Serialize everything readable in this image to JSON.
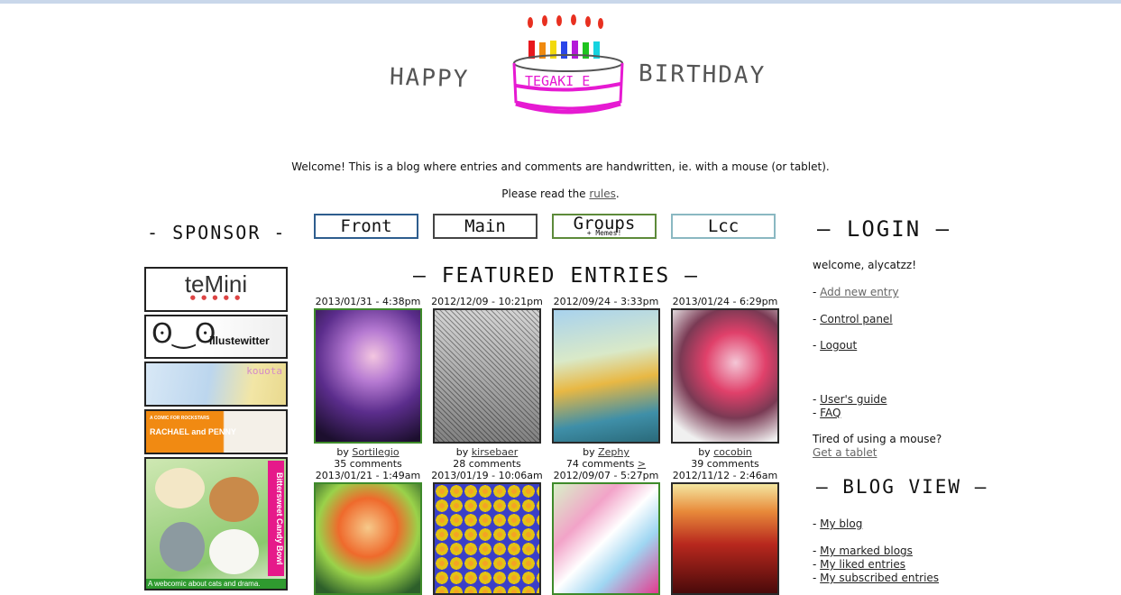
{
  "header": {
    "happy": "HAPPY",
    "birthday": "BIRTHDAY",
    "cake_text": "TEGAKI E",
    "welcome": "Welcome! This is a blog where entries and comments are handwritten, ie. with a mouse (or tablet).",
    "rules_prefix": "Please read the ",
    "rules_link": "rules",
    "rules_suffix": "."
  },
  "nav": {
    "front": "Front",
    "main": "Main",
    "groups": "Groups",
    "groups_sub": "+ Memes!",
    "lcc": "Lcc"
  },
  "sponsor": {
    "title": "- SPONSOR -",
    "temini": "teMini",
    "temini_dots": "● ● ● ● ●",
    "illustwitter": "illustewitter",
    "illus_face": "ʘ‿ʘ",
    "kouota": "kouota",
    "rachael_small": "A COMIC FOR ROCKSTARS",
    "rachael_title": "RACHAEL and PENNY",
    "cats_side": "Bittersweet Candy Bowl",
    "cats_caption": "A webcomic about cats and drama."
  },
  "featured": {
    "title": "— FEATURED ENTRIES —",
    "entries": [
      {
        "date": "2013/01/31 - 4:38pm",
        "author": "Sortilegio",
        "comments": "35 comments",
        "more": ""
      },
      {
        "date": "2012/12/09 - 10:21pm",
        "author": "kirsebaer",
        "comments": "28 comments",
        "more": ""
      },
      {
        "date": "2012/09/24 - 3:33pm",
        "author": "Zephy",
        "comments": "74 comments",
        "more": ">"
      },
      {
        "date": "2013/01/24 - 6:29pm",
        "author": "cocobin",
        "comments": "39 comments",
        "more": ""
      },
      {
        "date": "2013/01/21 - 1:49am",
        "author": "",
        "comments": "",
        "more": ""
      },
      {
        "date": "2013/01/19 - 10:06am",
        "author": "",
        "comments": "",
        "more": ""
      },
      {
        "date": "2012/09/07 - 5:27pm",
        "author": "",
        "comments": "",
        "more": ""
      },
      {
        "date": "2012/11/12 - 2:46am",
        "author": "",
        "comments": "",
        "more": ""
      }
    ]
  },
  "login": {
    "title": "— LOGIN —",
    "welcome": "welcome, alycatzz!",
    "add_entry": "Add new entry",
    "control_panel": "Control panel",
    "logout": "Logout",
    "users_guide": "User's guide",
    "faq": "FAQ",
    "tired": "Tired of using a mouse?",
    "get_tablet": "Get a tablet",
    "dash": "- ",
    "by": "by "
  },
  "blogview": {
    "title": "— BLOG VIEW —",
    "my_blog": "My blog",
    "marked": "My marked blogs",
    "liked": "My liked entries",
    "subscribed": "My subscribed entries"
  },
  "colors": {
    "front_border": "#2e5d8e",
    "groups_border": "#5d8a3a",
    "lcc_border": "#8ab8c2",
    "cake_pink": "#e61ad2"
  }
}
